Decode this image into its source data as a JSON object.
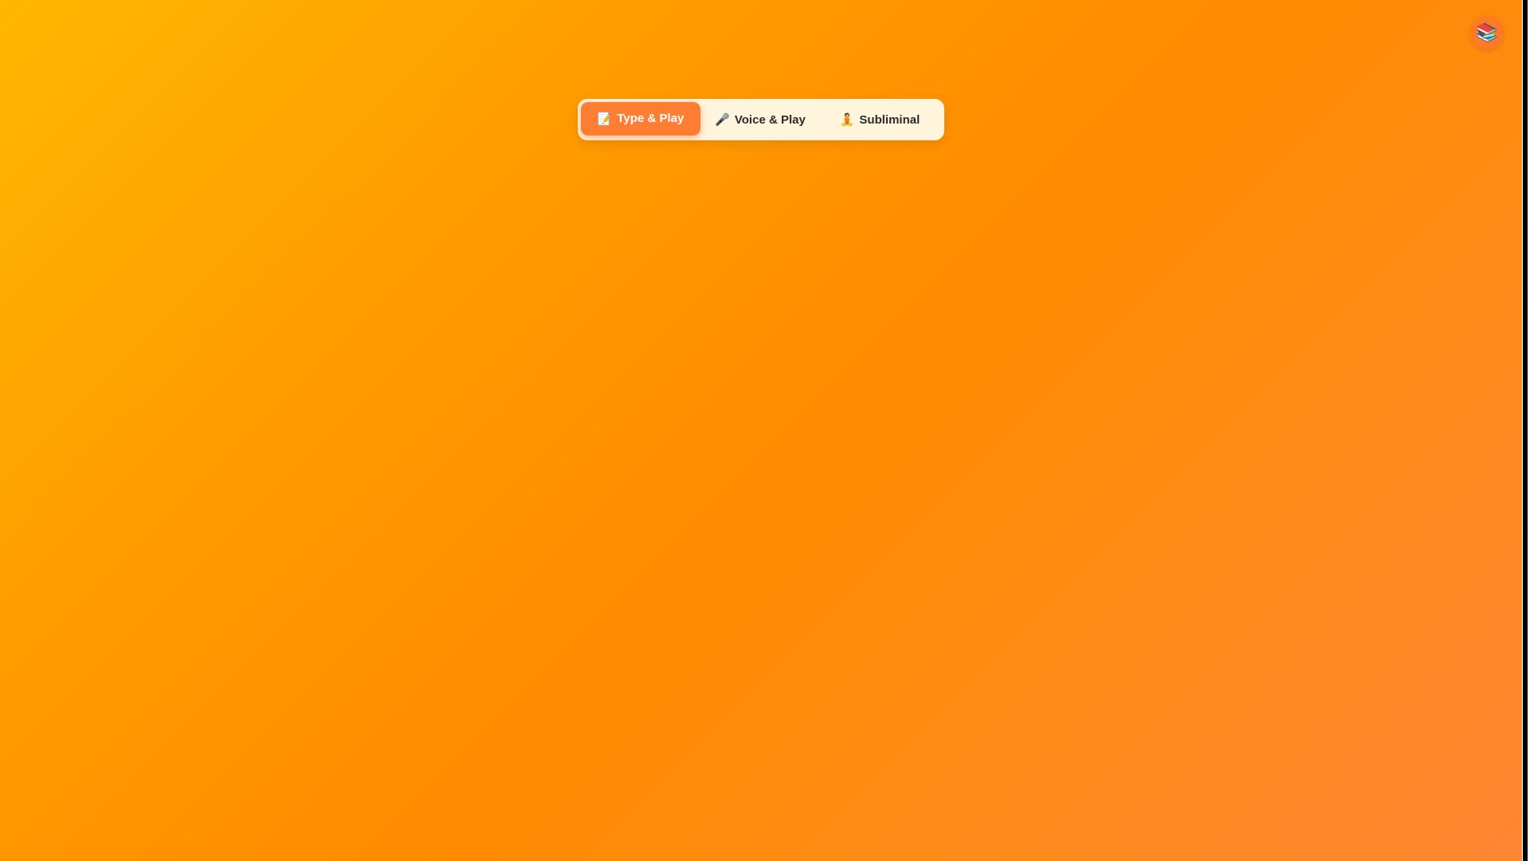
{
  "header": {
    "library_icon": "books-icon",
    "library_glyph": "📚"
  },
  "mode_tabs": {
    "active": "type_play",
    "items": [
      {
        "id": "type_play",
        "icon": "memo-icon",
        "glyph": "📝",
        "label": "Type & Play"
      },
      {
        "id": "voice_play",
        "icon": "microphone-icon",
        "glyph": "🎤",
        "label": "Voice & Play"
      },
      {
        "id": "subliminal",
        "icon": "meditation-icon",
        "glyph": "🧘",
        "label": "Subliminal"
      }
    ]
  },
  "colors": {
    "background_start": "#ffb700",
    "background_end": "#ff8633",
    "active_tab": "#ff7e33",
    "tab_bar": "#fff4dc"
  }
}
